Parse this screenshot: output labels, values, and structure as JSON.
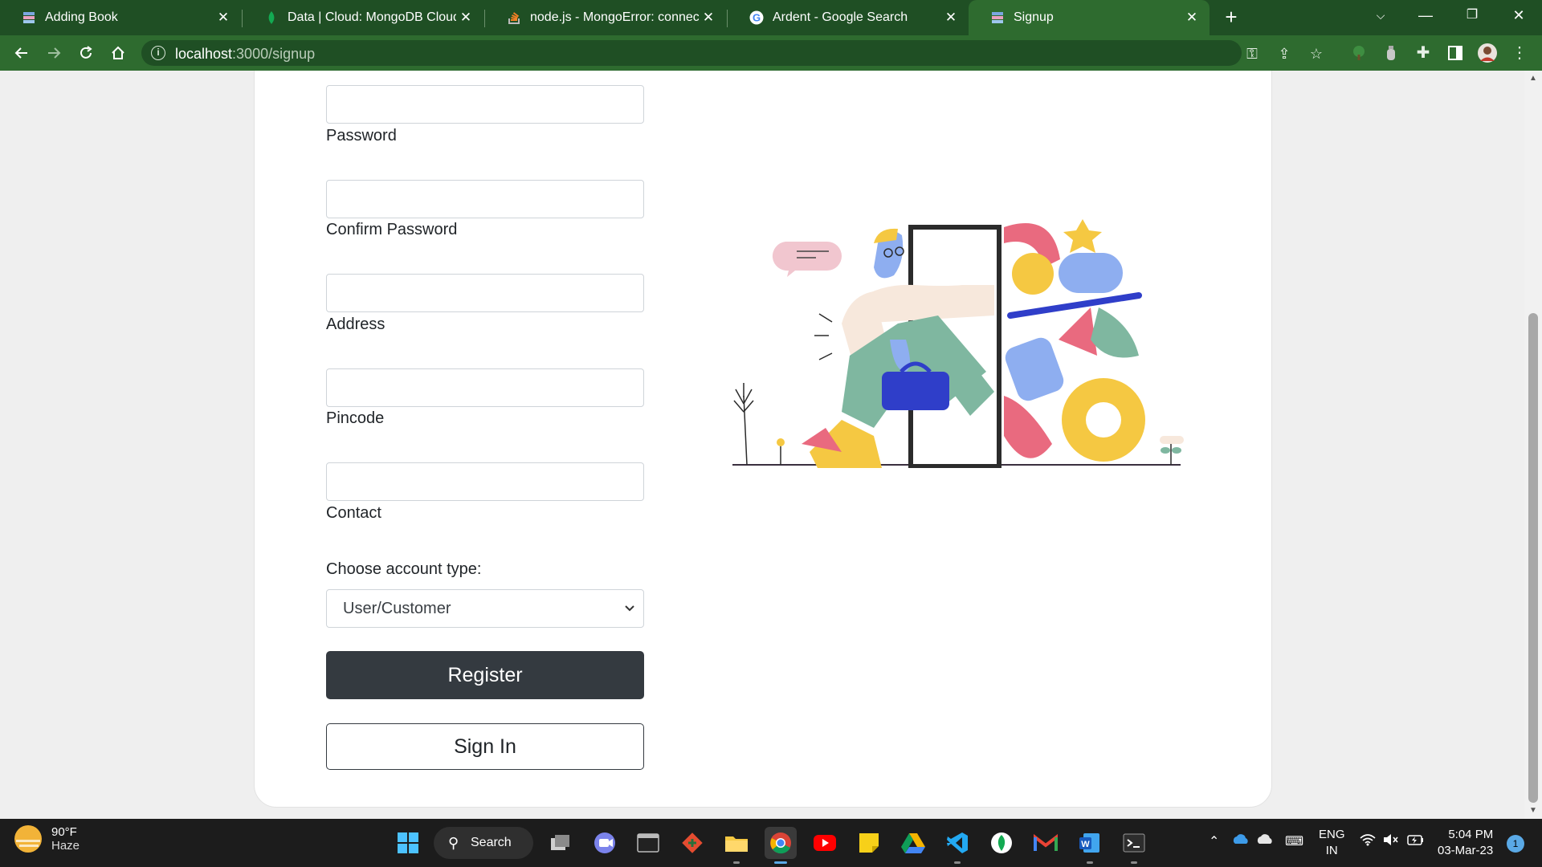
{
  "browser": {
    "tabs": [
      {
        "title": "Adding Book",
        "favicon": "book-favicon"
      },
      {
        "title": "Data | Cloud: MongoDB Cloud",
        "favicon": "mongodb-leaf-favicon"
      },
      {
        "title": "node.js - MongoError: connect EC",
        "favicon": "stackoverflow-favicon"
      },
      {
        "title": "Ardent - Google Search",
        "favicon": "google-favicon"
      },
      {
        "title": "Signup",
        "favicon": "book-favicon",
        "active": true
      }
    ],
    "url_host": "localhost",
    "url_path": ":3000/signup",
    "theme_color": "#2e6b2f"
  },
  "form": {
    "fields": [
      {
        "label": "Password",
        "value": ""
      },
      {
        "label": "Confirm Password",
        "value": ""
      },
      {
        "label": "Address",
        "value": ""
      },
      {
        "label": "Pincode",
        "value": ""
      },
      {
        "label": "Contact",
        "value": ""
      }
    ],
    "account_type_label": "Choose account type:",
    "account_type_selected": "User/Customer",
    "register_label": "Register",
    "signin_label": "Sign In",
    "primary_color": "#343a40"
  },
  "taskbar": {
    "weather_temp": "90°F",
    "weather_desc": "Haze",
    "search_label": "Search",
    "lang_line1": "ENG",
    "lang_line2": "IN",
    "time": "5:04 PM",
    "date": "03-Mar-23",
    "notification_count": "1",
    "pinned": [
      "start",
      "search",
      "task-view",
      "teams",
      "terminal",
      "git",
      "file-explorer",
      "chrome",
      "youtube",
      "sticky-notes",
      "google-drive",
      "vscode",
      "mongodb-compass",
      "gmail",
      "word",
      "terminal-2"
    ]
  }
}
